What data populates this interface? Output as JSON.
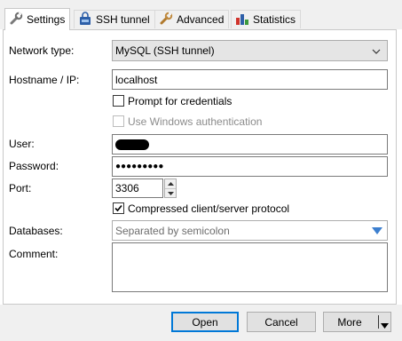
{
  "tabs": [
    {
      "label": "Settings",
      "icon": "wrench-icon",
      "active": true
    },
    {
      "label": "SSH tunnel",
      "icon": "ssh-tunnel-icon",
      "active": false
    },
    {
      "label": "Advanced",
      "icon": "wrench-icon",
      "active": false
    },
    {
      "label": "Statistics",
      "icon": "bar-chart-icon",
      "active": false
    }
  ],
  "form": {
    "network_type_label": "Network type:",
    "network_type_value": "MySQL (SSH tunnel)",
    "hostname_label": "Hostname / IP:",
    "hostname_value": "localhost",
    "prompt_credentials_label": "Prompt for credentials",
    "prompt_credentials_checked": false,
    "windows_auth_label": "Use Windows authentication",
    "windows_auth_checked": false,
    "windows_auth_enabled": false,
    "user_label": "User:",
    "user_value_redacted": true,
    "password_label": "Password:",
    "password_value": "●●●●●●●●●",
    "port_label": "Port:",
    "port_value": "3306",
    "compressed_label": "Compressed client/server protocol",
    "compressed_checked": true,
    "databases_label": "Databases:",
    "databases_placeholder": "Separated by semicolon",
    "comment_label": "Comment:",
    "comment_value": ""
  },
  "buttons": {
    "open": "Open",
    "cancel": "Cancel",
    "more": "More"
  },
  "colors": {
    "accent": "#0078d7",
    "dropdown_arrow": "#3c7fcf"
  }
}
